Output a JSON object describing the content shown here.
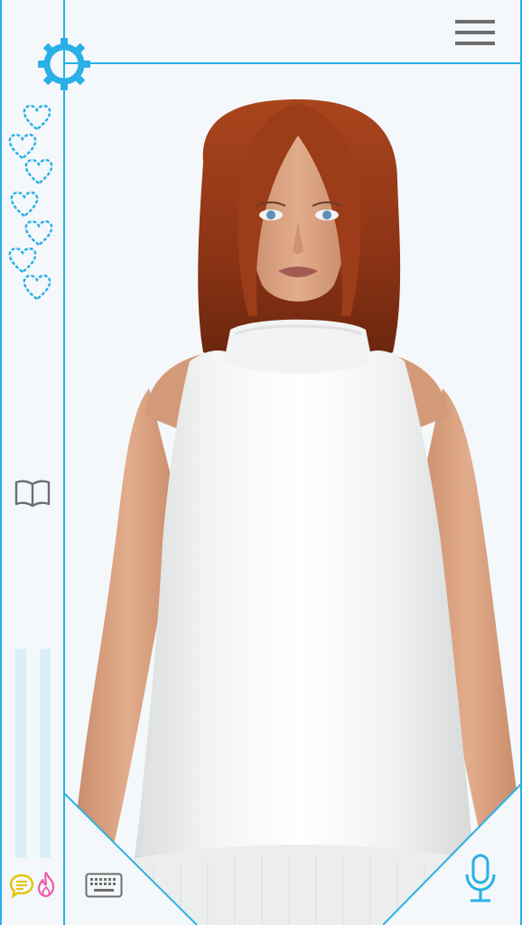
{
  "app": {
    "accent_color": "#2ab0e6",
    "background_color": "#f4f8fb"
  },
  "toolbar": {
    "settings_icon": "gear-icon",
    "menu_icon": "hamburger-menu-icon",
    "journal_icon": "open-book-icon",
    "keyboard_icon": "keyboard-icon",
    "mic_icon": "microphone-icon",
    "chat_icon": "chat-bubble-icon",
    "flame_icon": "flame-icon"
  },
  "affection": {
    "hearts_total": 7,
    "hearts_filled": 0,
    "heart_style": "dashed-outline"
  },
  "meters": {
    "left_level": 0,
    "right_level": 0
  },
  "character": {
    "description_hidden": true
  }
}
